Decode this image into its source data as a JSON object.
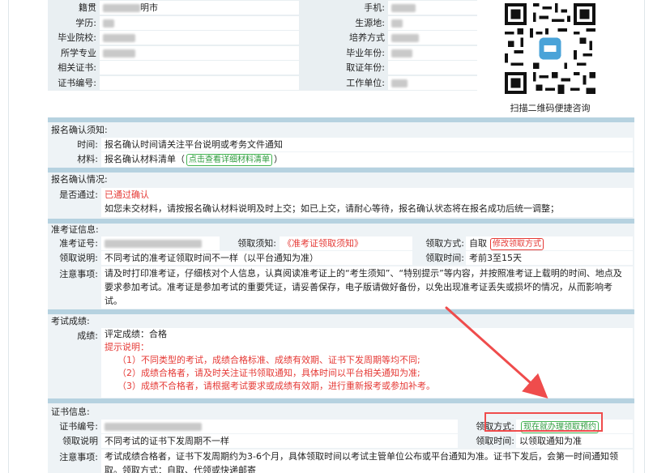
{
  "top_info": {
    "left": [
      {
        "label": "籍贯",
        "value": "明市",
        "blur": 46
      },
      {
        "label": "学历:",
        "value": "",
        "blur": 14
      },
      {
        "label": "毕业院校:",
        "value": "",
        "blur": 40
      },
      {
        "label": "所学专业",
        "value": "",
        "blur": 40
      },
      {
        "label": "相关证书:",
        "value": "",
        "blur": 0
      },
      {
        "label": "证书编号:",
        "value": "",
        "blur": 0
      }
    ],
    "right": [
      {
        "label": "手机:",
        "value": "",
        "blur": 30
      },
      {
        "label": "生源地:",
        "value": "",
        "blur": 14
      },
      {
        "label": "培养方式",
        "value": "",
        "blur": 34
      },
      {
        "label": "毕业年份:",
        "value": "",
        "blur": 26
      },
      {
        "label": "取证年份:",
        "value": "",
        "blur": 0
      },
      {
        "label": "工作单位:",
        "value": "",
        "blur": 20
      }
    ]
  },
  "qr": {
    "caption": "扫描二维码便捷咨询",
    "icon": "qr-code-icon"
  },
  "confirm_notice": {
    "title": "报名确认须知:",
    "time_label": "时间:",
    "time_value": "报名确认时间请关注平台说明或考务文件通知",
    "material_label": "材料:",
    "material_prefix": "报名确认材料清单（",
    "material_button": "点击查看详细材料清单",
    "material_suffix": "）"
  },
  "confirm_status": {
    "title": "报名确认情况:",
    "pass_label": "是否通过:",
    "pass_value": "已通过确认",
    "note": "如您未交材料，请按报名确认材料说明及时上交；如已上交，请耐心等待，报名确认状态将在报名成功后统一调整；"
  },
  "admission": {
    "title": "准考证信息:",
    "number_label": "准考证号:",
    "notice_label": "领取须知:",
    "notice_value": "《准考证领取须知》",
    "method_label": "领取方式:",
    "method_value": "自取",
    "method_button": "修改领取方式",
    "explain_label": "领取说明:",
    "explain_value": "不同考试的准考证领取时间不一样（以平台通知为准）",
    "time_label": "领取时间:",
    "time_value": "考前3至15天",
    "attention_label": "注意事项:",
    "attention_value": "请及时打印准考证，仔细核对个人信息，认真阅读准考证上的“考生须知”、“特别提示”等内容，并按照准考证上载明的时间、地点及要求参加考试。准考证是参加考试的重要凭证，请妥善保存，电子版请做好备份，以免出现准考证丢失或损坏的情况，从而影响考试。"
  },
  "score": {
    "title": "考试成绩:",
    "score_label": "成绩:",
    "score_value": "评定成绩：合格",
    "tips_title": "提示说明：",
    "tips": [
      "（1）不同类型的考试，成绩合格标准、成绩有效期、证书下发周期等均不同;",
      "（2）成绩合格者，请及时关注证书领取通知，具体时间以平台相关通知为准;",
      "（3）成绩不合格者，请根据考试要求或成绩有效期，进行重新报考或参加补考。"
    ]
  },
  "certificate": {
    "title": "证书信息:",
    "number_label": "证书编号:",
    "method_label": "领取方式:",
    "method_button": "现在就办理领取预约",
    "explain_label": "领取说明",
    "explain_value": "不同考试的证书下发周期不一样",
    "time_label": "领取时间:",
    "time_value": "以领取通知为准",
    "attention_label": "注意事项:",
    "attention_value": "考试成绩合格者，证书下发周期约为3-6个月，具体领取时间以考试主管单位公布或平台通知为准。证书下发后，会第一时间通知领取。领取方式：自取、代领或快递邮寄"
  },
  "colors": {
    "accent_bar": "#b6d2e0",
    "section_bg": "#eef3f6",
    "red": "#e53935",
    "green": "#2e9b3e",
    "annotation": "#ef4c4c"
  }
}
